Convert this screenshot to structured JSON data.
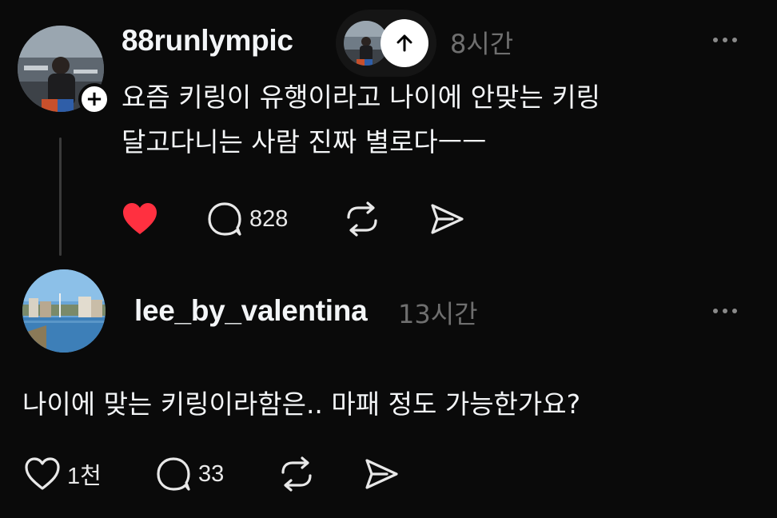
{
  "post": {
    "username": "88runlympic",
    "timestamp": "8시간",
    "text_line1": "요즘 키링이 유행이라고 나이에 안맞는 키링",
    "text_line2": "달고다니는 사람 진짜 별로다ㅡㅡ",
    "liked": true,
    "like_color": "#ff3040",
    "comment_count": "828",
    "icons": [
      "follow-plus-icon",
      "arrow-up-icon",
      "more-icon",
      "heart-filled-icon",
      "comment-icon",
      "repost-icon",
      "share-icon"
    ]
  },
  "reply": {
    "username": "lee_by_valentina",
    "timestamp": "13시간",
    "text": "나이에 맞는 키링이라함은.. 마패 정도 가능한가요?",
    "like_count": "1천",
    "comment_count": "33",
    "icons": [
      "more-icon",
      "heart-outline-icon",
      "comment-icon",
      "repost-icon",
      "share-icon"
    ]
  },
  "colors": {
    "background": "#0a0a0a",
    "text_primary": "#f3f5f7",
    "text_secondary": "#6f6f6f"
  }
}
